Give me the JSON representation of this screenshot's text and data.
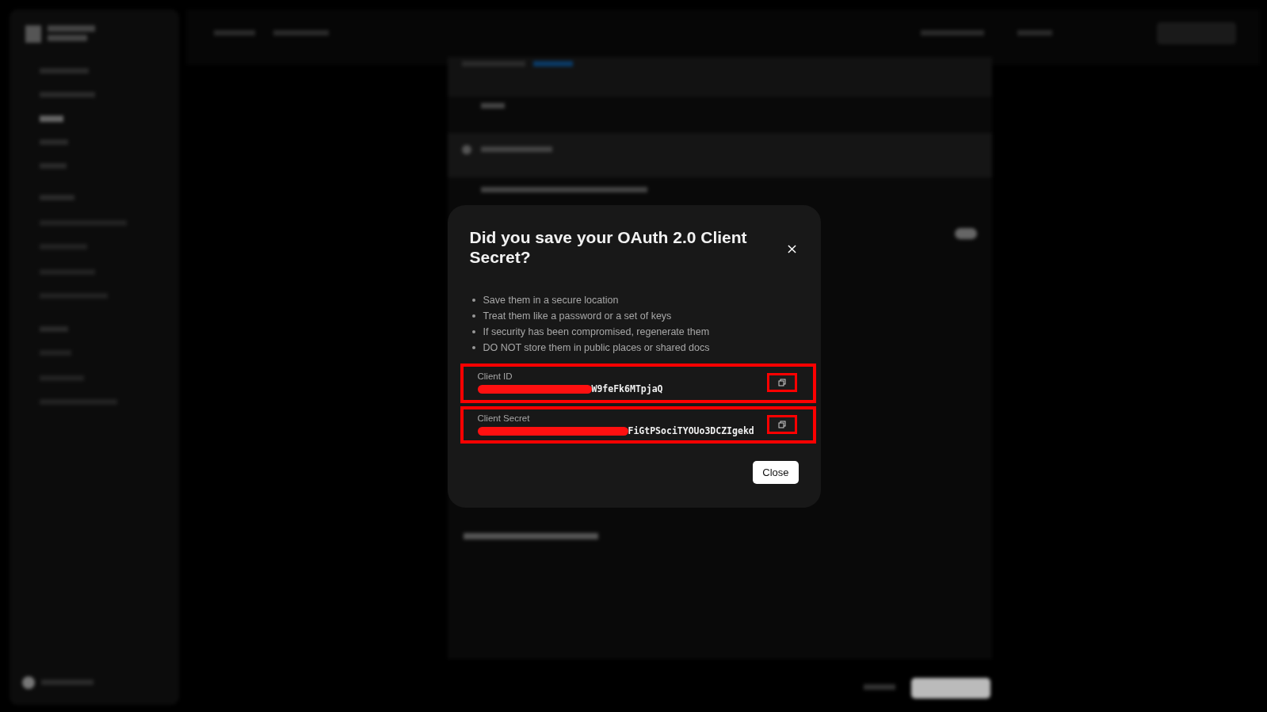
{
  "dialog": {
    "title": "Did you save your OAuth 2.0 Client Secret?",
    "tips": [
      "Save them in a secure location",
      "Treat them like a password or a set of keys",
      "If security has been compromised, regenerate them",
      "DO NOT store them in public places or shared docs"
    ],
    "credentials": [
      {
        "label": "Client ID",
        "value": "W9feFk6MTpjaQ",
        "redacted": true
      },
      {
        "label": "Client Secret",
        "value": "FiGtPSociTYOUo3DCZIgekd",
        "redacted": true
      }
    ],
    "close_button": "Close"
  }
}
